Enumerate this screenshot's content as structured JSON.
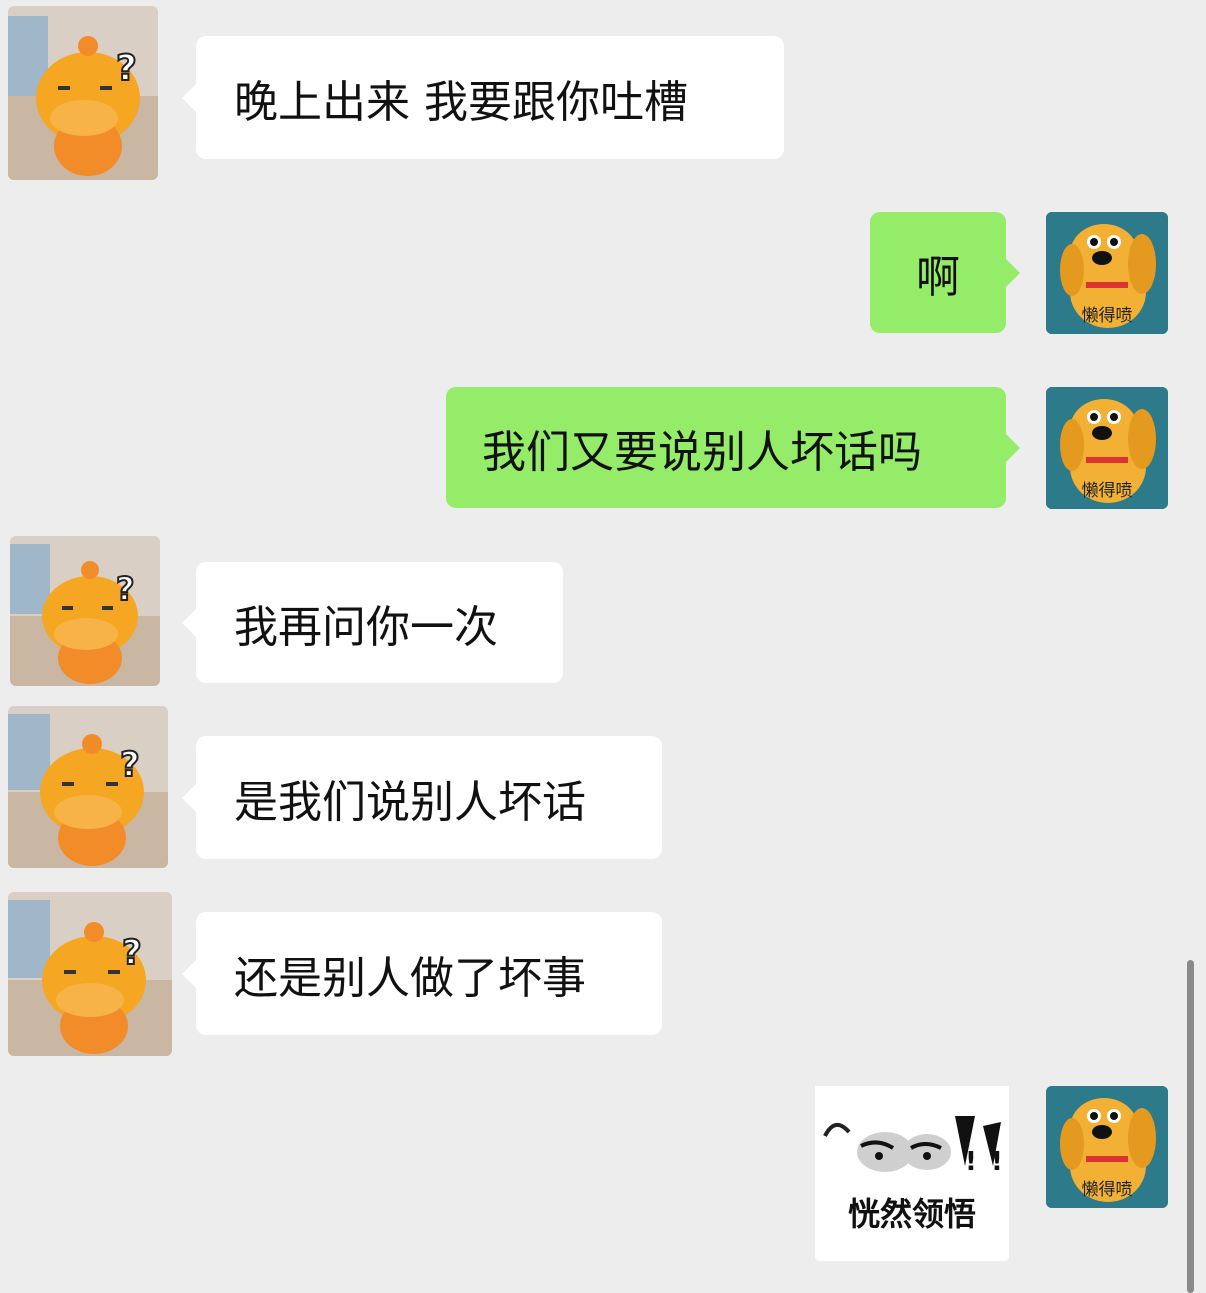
{
  "chat": {
    "messages": [
      {
        "sender": "left",
        "text": "晚上出来  我要跟你吐槽"
      },
      {
        "sender": "right",
        "text": "啊"
      },
      {
        "sender": "right",
        "text": "我们又要说别人坏话吗"
      },
      {
        "sender": "left",
        "text": "我再问你一次"
      },
      {
        "sender": "left",
        "text": "是我们说别人坏话"
      },
      {
        "sender": "left",
        "text": "还是别人做了坏事"
      },
      {
        "sender": "right",
        "type": "sticker",
        "text": "恍然领悟"
      }
    ]
  },
  "avatars": {
    "left": {
      "icon": "orange-cartoon-character-question-mark"
    },
    "right": {
      "icon": "yellow-dog-cartoon",
      "caption": "懒得喷"
    }
  },
  "colors": {
    "background": "#ededed",
    "incoming_bubble": "#ffffff",
    "outgoing_bubble": "#95ec69"
  }
}
